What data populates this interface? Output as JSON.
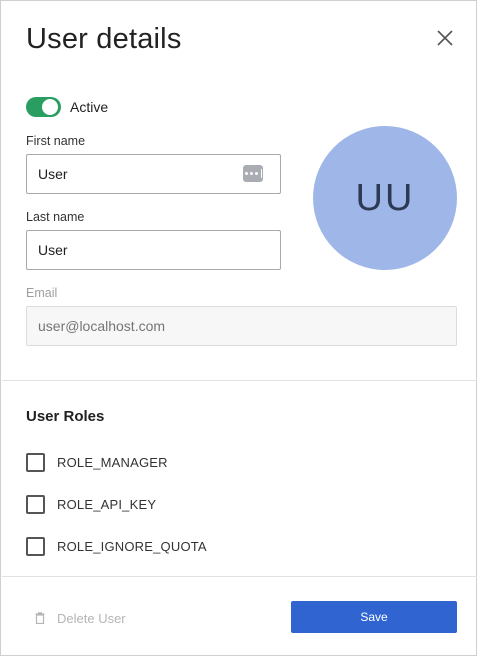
{
  "dialog": {
    "title": "User details",
    "close_icon": "close-icon"
  },
  "status": {
    "toggle_on": true,
    "label": "Active",
    "accent_color": "#2a9d60"
  },
  "form": {
    "first_name": {
      "label": "First name",
      "value": "User",
      "icon": "password-dots-icon"
    },
    "last_name": {
      "label": "Last name",
      "value": "User"
    },
    "email": {
      "label": "Email",
      "placeholder": "user@localhost.com"
    }
  },
  "avatar": {
    "initials": "UU",
    "color": "#9fb6e8"
  },
  "roles": {
    "title": "User Roles",
    "items": [
      {
        "label": "ROLE_MANAGER",
        "checked": false
      },
      {
        "label": "ROLE_API_KEY",
        "checked": false
      },
      {
        "label": "ROLE_IGNORE_QUOTA",
        "checked": false
      }
    ]
  },
  "footer": {
    "delete_label": "Delete User",
    "delete_icon": "trash-icon",
    "save_label": "Save",
    "save_color": "#3065d1"
  }
}
